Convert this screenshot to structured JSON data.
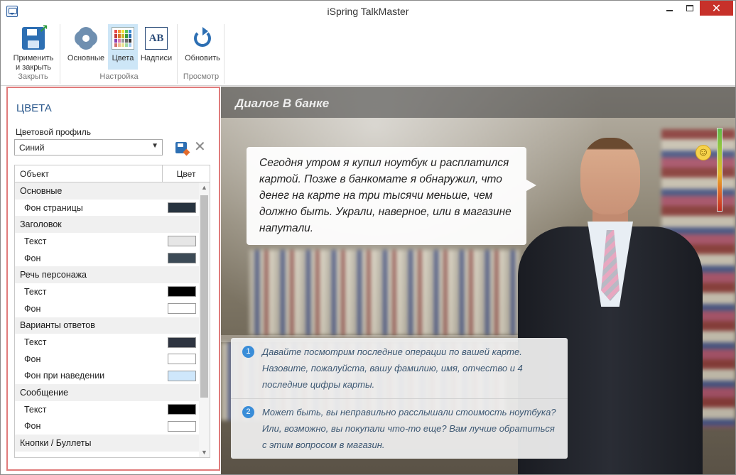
{
  "window": {
    "title": "iSpring TalkMaster",
    "close_glyph": "✕"
  },
  "ribbon": {
    "groups": [
      {
        "label": "Закрыть",
        "buttons": [
          {
            "label_line1": "Применить",
            "label_line2": "и закрыть",
            "icon": "save-icon"
          }
        ]
      },
      {
        "label": "Настройка",
        "buttons": [
          {
            "label": "Основные",
            "icon": "gear-icon"
          },
          {
            "label": "Цвета",
            "icon": "palette-icon",
            "active": true
          },
          {
            "label": "Надписи",
            "icon": "text-icon",
            "icon_text": "AB"
          }
        ]
      },
      {
        "label": "Просмотр",
        "buttons": [
          {
            "label": "Обновить",
            "icon": "refresh-icon"
          }
        ]
      }
    ]
  },
  "panel": {
    "title": "ЦВЕТА",
    "profile_label": "Цветовой профиль",
    "profile_value": "Синий",
    "columns": {
      "object": "Объект",
      "color": "Цвет"
    },
    "rows": [
      {
        "type": "group",
        "label": "Основные"
      },
      {
        "type": "item",
        "label": "Фон страницы",
        "color": "#283440"
      },
      {
        "type": "group",
        "label": "Заголовок"
      },
      {
        "type": "item",
        "label": "Текст",
        "color": "#e6e6e6"
      },
      {
        "type": "item",
        "label": "Фон",
        "color": "#3c4a56"
      },
      {
        "type": "group",
        "label": "Речь персонажа"
      },
      {
        "type": "item",
        "label": "Текст",
        "color": "#000000"
      },
      {
        "type": "item",
        "label": "Фон",
        "color": "#ffffff"
      },
      {
        "type": "group",
        "label": "Варианты ответов"
      },
      {
        "type": "item",
        "label": "Текст",
        "color": "#2e3440"
      },
      {
        "type": "item",
        "label": "Фон",
        "color": "#ffffff"
      },
      {
        "type": "item",
        "label": "Фон при наведении",
        "color": "#cfe7fb"
      },
      {
        "type": "group",
        "label": "Сообщение"
      },
      {
        "type": "item",
        "label": "Текст",
        "color": "#000000"
      },
      {
        "type": "item",
        "label": "Фон",
        "color": "#ffffff"
      },
      {
        "type": "group",
        "label": "Кнопки / Буллеты"
      }
    ]
  },
  "preview": {
    "title": "Диалог В банке",
    "speech": "Сегодня утром я купил ноутбук и расплатился картой. Позже в банкомате я обнаружил, что денег на карте на три тысячи меньше, чем должно быть. Украли, наверное, или в магазине напутали.",
    "mood_level": 0.85,
    "answers": [
      {
        "num": "1",
        "text": "Давайте посмотрим последние операции по вашей карте. Назовите, пожалуйста, вашу фамилию, имя, отчество и 4 последние цифры карты."
      },
      {
        "num": "2",
        "text": "Может быть, вы неправильно расслышали стоимость ноутбука? Или, возможно, вы покупали что-то еще? Вам лучше обратиться с этим вопросом в магазин."
      }
    ]
  }
}
